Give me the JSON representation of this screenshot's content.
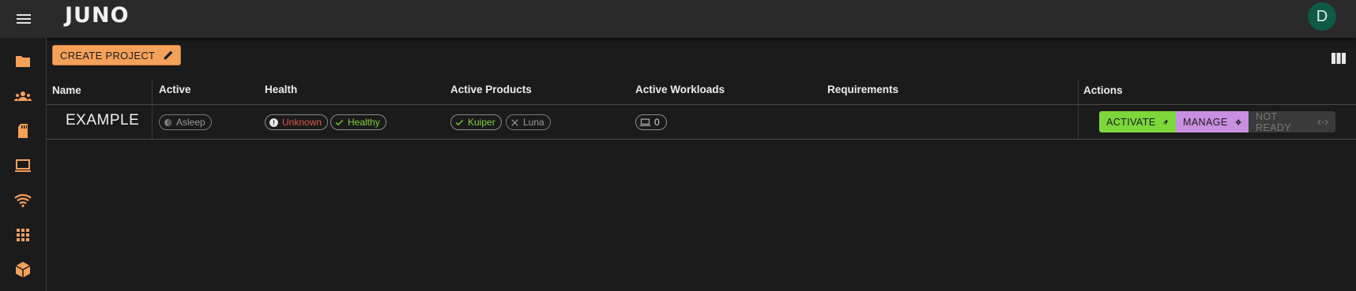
{
  "app": {
    "logo_text": "JUNO",
    "avatar_initial": "D"
  },
  "toolbar": {
    "create_label": "CREATE PROJECT"
  },
  "columns": [
    "Name",
    "Active",
    "Health",
    "Active Products",
    "Active Workloads",
    "Requirements",
    "Actions"
  ],
  "rows": [
    {
      "name": "EXAMPLE",
      "active": "Asleep",
      "health": [
        "Unknown",
        "Healthy"
      ],
      "products": [
        "Kuiper",
        "Luna"
      ],
      "workloads": "0",
      "actions": {
        "activate": "ACTIVATE",
        "manage": "MANAGE",
        "not_ready": "NOT READY"
      }
    }
  ],
  "sidebar": {
    "items": [
      "folder-icon",
      "groups-icon",
      "sd-card-icon",
      "laptop-icon",
      "wifi-icon",
      "apps-grid-icon",
      "package-icon"
    ]
  },
  "colors": {
    "accent": "#f5a15a",
    "activate": "#7dd63a",
    "manage": "#c98fe0",
    "avatar": "#0f5a45",
    "unknown": "#e0554a",
    "healthy": "#7fd23a"
  }
}
